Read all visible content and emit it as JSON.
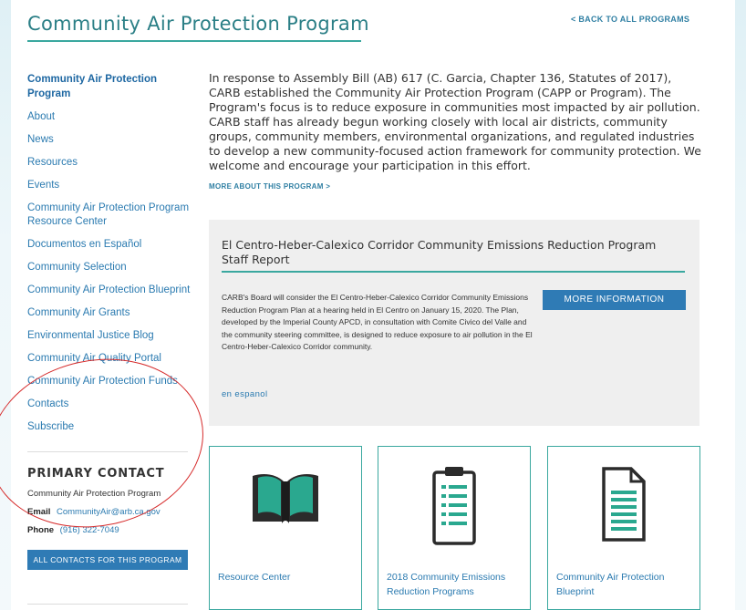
{
  "header": {
    "title": "Community Air Protection Program",
    "back_link": "< BACK TO ALL PROGRAMS"
  },
  "sidebar": {
    "items": [
      {
        "label": "Community Air Protection Program",
        "active": true
      },
      {
        "label": "About"
      },
      {
        "label": "News"
      },
      {
        "label": "Resources"
      },
      {
        "label": "Events"
      },
      {
        "label": "Community Air Protection Program Resource Center"
      },
      {
        "label": "Documentos en Español"
      },
      {
        "label": "Community Selection"
      },
      {
        "label": "Community Air Protection Blueprint"
      },
      {
        "label": "Community Air Grants"
      },
      {
        "label": "Environmental Justice Blog"
      },
      {
        "label": "Community Air Quality Portal"
      },
      {
        "label": "Community Air Protection Funds"
      },
      {
        "label": "Contacts"
      },
      {
        "label": "Subscribe"
      }
    ]
  },
  "contact": {
    "heading": "PRIMARY CONTACT",
    "name": "Community Air Protection Program",
    "email_label": "Email",
    "email": "CommunityAir@arb.ca.gov",
    "phone_label": "Phone",
    "phone": "(916) 322-7049",
    "button": "ALL CONTACTS FOR THIS PROGRAM"
  },
  "main": {
    "intro": "In response to Assembly Bill (AB) 617 (C. Garcia, Chapter 136, Statutes of 2017), CARB established the Community Air Protection Program (CAPP or Program). The Program's focus is to reduce exposure in communities most impacted by air pollution. CARB staff has already begun working closely with local air districts, community groups, community members, environmental organizations, and regulated industries to develop a new community-focused action framework for community protection. We welcome and encourage your participation in this effort.",
    "more_link": "MORE ABOUT THIS PROGRAM >",
    "feature": {
      "title": "El Centro-Heber-Calexico Corridor Community Emissions Reduction Program Staff Report",
      "text": "CARB's Board will consider the El Centro-Heber-Calexico Corridor Community Emissions Reduction Program Plan at a hearing held in El Centro on January 15, 2020. The Plan, developed by the Imperial County APCD, in consultation with Comite Civico del Valle and the community steering committee, is designed to reduce exposure to air pollution in the El Centro-Heber-Calexico Corridor community.",
      "button": "MORE INFORMATION",
      "espanol": "en espanol"
    },
    "cards": [
      {
        "label": "Resource Center",
        "icon": "book-icon"
      },
      {
        "label": "2018 Community Emissions Reduction Programs",
        "icon": "clipboard-icon"
      },
      {
        "label": "Community Air Protection Blueprint",
        "icon": "document-icon"
      }
    ]
  },
  "colors": {
    "accent_teal": "#3aa89f",
    "link_blue": "#2a7ab0",
    "button_blue": "#2f7bb5",
    "icon_dark": "#2b2b2b",
    "icon_teal": "#2aa88f",
    "annotation_red": "#d62b2b"
  }
}
